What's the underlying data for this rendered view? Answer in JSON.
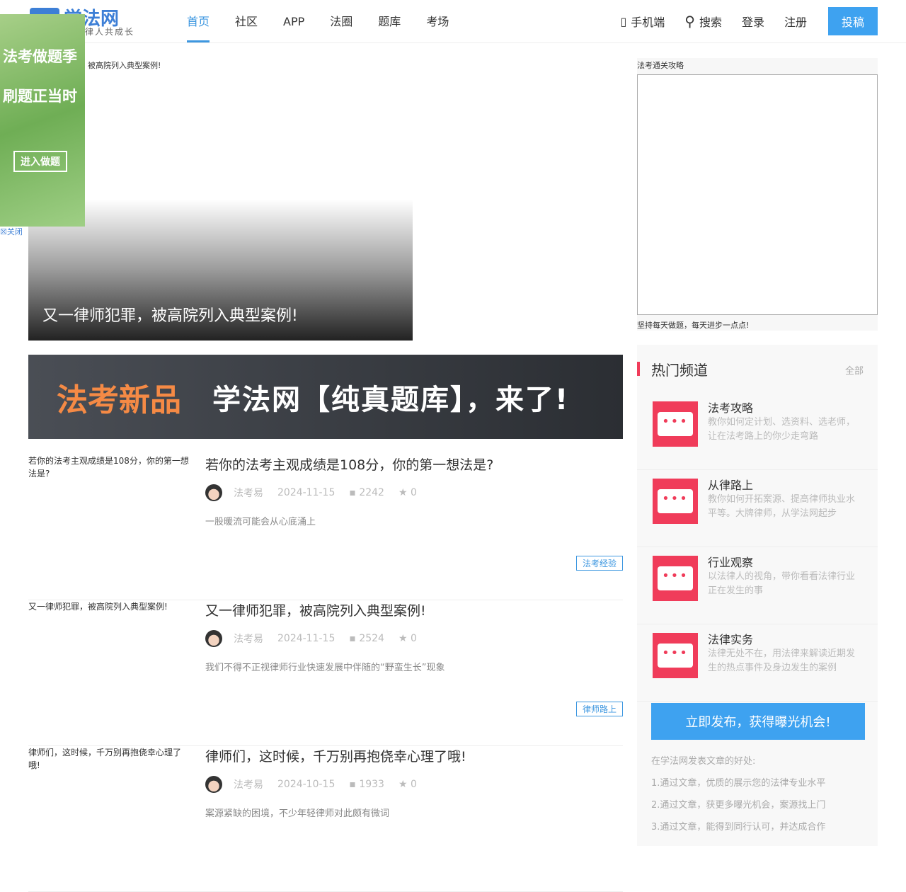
{
  "header": {
    "logo": "学法网",
    "slogan": "律人共成长",
    "nav": [
      "首页",
      "社区",
      "APP",
      "法圈",
      "题库",
      "考场"
    ],
    "mobile": "手机端",
    "search": "搜索",
    "login": "登录",
    "register": "注册",
    "submit": "投稿"
  },
  "ad": {
    "line1": "法考做题季",
    "line2": "刷题正当时",
    "button": "进入做题",
    "close": "☒关闭"
  },
  "featured": {
    "small_caption": "被高院列入典型案例!",
    "caption": "又一律师犯罪，被高院列入典型案例!"
  },
  "banner": {
    "left": "法考新品",
    "right": "学法网【纯真题库】，来了!"
  },
  "articles": [
    {
      "thumb_title": "若你的法考主观成绩是108分，你的第一想法是?",
      "title": "若你的法考主观成绩是108分，你的第一想法是?",
      "author": "法考易",
      "date": "2024-11-15",
      "comments": "2242",
      "stars": "0",
      "excerpt": "一股暖流可能会从心底涌上",
      "tag": "法考经验"
    },
    {
      "thumb_title": "又一律师犯罪，被高院列入典型案例!",
      "title": "又一律师犯罪，被高院列入典型案例!",
      "author": "法考易",
      "date": "2024-11-15",
      "comments": "2524",
      "stars": "0",
      "excerpt": "我们不得不正视律师行业快速发展中伴随的“野蛮生长”现象",
      "tag": "律师路上"
    },
    {
      "thumb_title": "律师们，这时候，千万别再抱侥幸心理了哦!",
      "title": "律师们，这时候，千万别再抱侥幸心理了哦!",
      "author": "法考易",
      "date": "2024-10-15",
      "comments": "1933",
      "stars": "0",
      "excerpt": "案源紧缺的困境，不少年轻律师对此颇有微词",
      "tag": ""
    }
  ],
  "sidebar": {
    "guide_title": "法考通关攻略",
    "guide_footer": "坚持每天做题，每天进步一点点!",
    "hot_title": "热门频道",
    "all": "全部",
    "channels": [
      {
        "name": "法考攻略",
        "desc": "教你如何定计划、选资料、选老师，让在法考路上的你少走弯路"
      },
      {
        "name": "从律路上",
        "desc": "教你如何开拓案源、提高律师执业水平等。大牌律师，从学法网起步"
      },
      {
        "name": "行业观察",
        "desc": "以法律人的视角，带你看看法律行业正在发生的事"
      },
      {
        "name": "法律实务",
        "desc": "法律无处不在，用法律来解读近期发生的热点事件及身边发生的案例"
      }
    ],
    "publish": "立即发布，获得曝光机会!",
    "benefits_title": "在学法网发表文章的好处:",
    "benefits": [
      "1.通过文章，优质的展示您的法律专业水平",
      "2.通过文章，获更多曝光机会，案源找上门",
      "3.通过文章，能得到同行认可，并达成合作"
    ]
  }
}
